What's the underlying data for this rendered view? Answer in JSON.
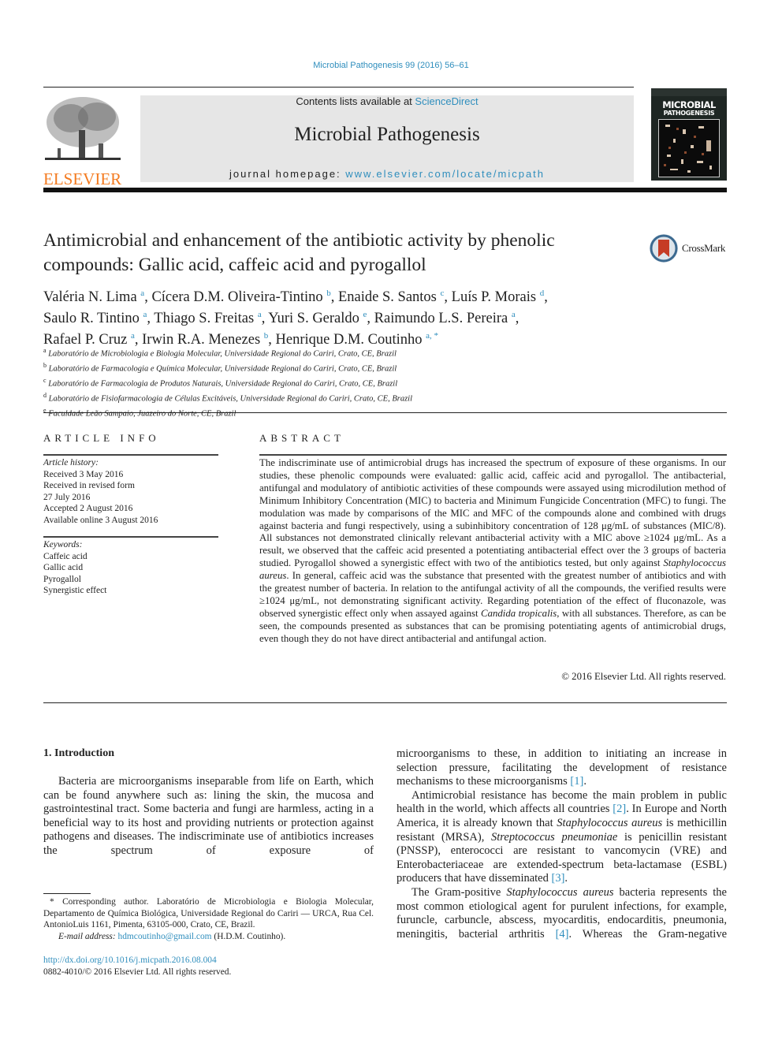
{
  "header": {
    "journal_ref": "Microbial Pathogenesis 99 (2016) 56–61",
    "contents_prefix": "Contents lists available at ",
    "contents_link": "ScienceDirect",
    "journal_name": "Microbial Pathogenesis",
    "homepage_prefix": "journal homepage: ",
    "homepage_link": "www.elsevier.com/locate/micpath",
    "publisher_logo_text": "ELSEVIER",
    "cover_title_1": "MICROBIAL",
    "cover_title_2": "PATHOGENESIS",
    "crossmark_label": "CrossMark",
    "colors": {
      "link": "#2f8ebd",
      "elsevier_orange": "#f47b20",
      "cover_bg": "#1e2623",
      "header_bg": "#e6e6e6"
    }
  },
  "article": {
    "title_line1": "Antimicrobial and enhancement of the antibiotic activity by phenolic",
    "title_line2": "compounds: Gallic acid, caffeic acid and pyrogallol",
    "authors": [
      {
        "name": "Valéria N. Lima",
        "aff": "a",
        "sep": ", "
      },
      {
        "name": "Cícera D.M. Oliveira-Tintino",
        "aff": "b",
        "sep": ", "
      },
      {
        "name": "Enaide S. Santos",
        "aff": "c",
        "sep": ", "
      },
      {
        "name": "Luís P. Morais",
        "aff": "d",
        "sep": ","
      },
      {
        "name": "Saulo R. Tintino",
        "aff": "a",
        "sep": ", "
      },
      {
        "name": "Thiago S. Freitas",
        "aff": "a",
        "sep": ", "
      },
      {
        "name": "Yuri S. Geraldo",
        "aff": "e",
        "sep": ", "
      },
      {
        "name": "Raimundo L.S. Pereira",
        "aff": "a",
        "sep": ","
      },
      {
        "name": "Rafael P. Cruz",
        "aff": "a",
        "sep": ", "
      },
      {
        "name": "Irwin R.A. Menezes",
        "aff": "b",
        "sep": ", "
      },
      {
        "name": "Henrique D.M. Coutinho",
        "aff": "a, *",
        "sep": ""
      }
    ],
    "affiliations": [
      {
        "key": "a",
        "text": "Laboratório de Microbiologia e Biologia Molecular, Universidade Regional do Cariri, Crato, CE, Brazil"
      },
      {
        "key": "b",
        "text": "Laboratório de Farmacologia e Química Molecular, Universidade Regional do Cariri, Crato, CE, Brazil"
      },
      {
        "key": "c",
        "text": "Laboratório de Farmacologia de Produtos Naturais, Universidade Regional do Cariri, Crato, CE, Brazil"
      },
      {
        "key": "d",
        "text": "Laboratório de Fisiofarmacologia de Células Excitáveis, Universidade Regional do Cariri, Crato, CE, Brazil"
      },
      {
        "key": "e",
        "text": "Faculdade Leão Sampaio, Juazeiro do Norte, CE, Brazil"
      }
    ]
  },
  "article_info": {
    "heading": "ARTICLE INFO",
    "history_label": "Article history:",
    "history": [
      "Received 3 May 2016",
      "Received in revised form",
      "27 July 2016",
      "Accepted 2 August 2016",
      "Available online 3 August 2016"
    ],
    "keywords_label": "Keywords:",
    "keywords": [
      "Caffeic acid",
      "Gallic acid",
      "Pyrogallol",
      "Synergistic effect"
    ]
  },
  "abstract": {
    "heading": "ABSTRACT",
    "p1": "The indiscriminate use of antimicrobial drugs has increased the spectrum of exposure of these organisms. In our studies, these phenolic compounds were evaluated: gallic acid, caffeic acid and pyrogallol. The antibacterial, antifungal and modulatory of antibiotic activities of these compounds were assayed using microdilution method of Minimum Inhibitory Concentration (MIC) to bacteria and Minimum Fungicide Concentration (MFC) to fungi. The modulation was made by comparisons of the MIC and MFC of the compounds alone and combined with drugs against bacteria and fungi respectively, using a subinhibitory concentration of 128 μg/mL of substances (MIC/8). All substances not demonstrated clinically relevant antibacterial activity with a MIC above ≥1024 μg/mL. As a result, we observed that the caffeic acid presented a potentiating antibacterial effect over the 3 groups of bacteria studied. Pyrogallol showed a synergistic effect with two of the antibiotics tested, but only against ",
    "italic1": "Staphylococcus aureus",
    "p2": ". In general, caffeic acid was the substance that presented with the greatest number of antibiotics and with the greatest number of bacteria. In relation to the antifungal activity of all the compounds, the verified results were ≥1024 μg/mL, not demonstrating significant activity. Regarding potentiation of the effect of fluconazole, was observed synergistic effect only when assayed against ",
    "italic2": "Candida tropicalis",
    "p3": ", with all substances. Therefore, as can be seen, the compounds presented as substances that can be promising potentiating agents of antimicrobial drugs, even though they do not have direct antibacterial and antifungal action.",
    "copyright": "© 2016 Elsevier Ltd. All rights reserved."
  },
  "introduction": {
    "heading": "1.  Introduction",
    "left_p1": "Bacteria are microorganisms inseparable from life on Earth, which can be found anywhere such as: lining the skin, the mucosa and gastrointestinal tract. Some bacteria and fungi are harmless, acting in a beneficial way to its host and providing nutrients or protection against pathogens and diseases. The indiscriminate use of antibiotics increases the spectrum of exposure of",
    "right_p1": "microorganisms to these, in addition to initiating an increase in selection pressure, facilitating the development of resistance mechanisms to these microorganisms ",
    "ref1": "[1]",
    "right_p2a": "Antimicrobial resistance has become the main problem in public health in the world, which affects all countries ",
    "ref2": "[2]",
    "right_p2b": ". In Europe and North America, it is already known that ",
    "right_p2_it1": "Staphylococcus aureus",
    "right_p2c": " is methicillin resistant (MRSA), ",
    "right_p2_it2": "Streptococcus pneumoniae",
    "right_p2d": " is penicillin resistant (PNSSP), enterococci are resistant to vancomycin (VRE) and Enterobacteriaceae are extended-spectrum beta-lactamase (ESBL) producers that have disseminated ",
    "ref3": "[3]",
    "right_p3a": "The Gram-positive ",
    "right_p3_it": "Staphylococcus aureus",
    "right_p3b": " bacteria represents the most common etiological agent for purulent infections, for example, furuncle, carbuncle, abscess, myocarditis, endocarditis, pneumonia, meningitis, bacterial arthritis ",
    "ref4": "[4]",
    "right_p3c": ". Whereas the Gram-negative"
  },
  "footnote": {
    "corresponding": "* Corresponding author. Laboratório de Microbiologia e Biologia Molecular, Departamento de Química Biológica, Universidade Regional do Cariri — URCA, Rua Cel. AntonioLuis 1161, Pimenta, 63105-000, Crato, CE, Brazil.",
    "email_label": "E-mail address:",
    "email": "hdmcoutinho@gmail.com",
    "email_suffix": " (H.D.M. Coutinho).",
    "doi": "http://dx.doi.org/10.1016/j.micpath.2016.08.004",
    "issn": "0882-4010/© 2016 Elsevier Ltd. All rights reserved."
  }
}
